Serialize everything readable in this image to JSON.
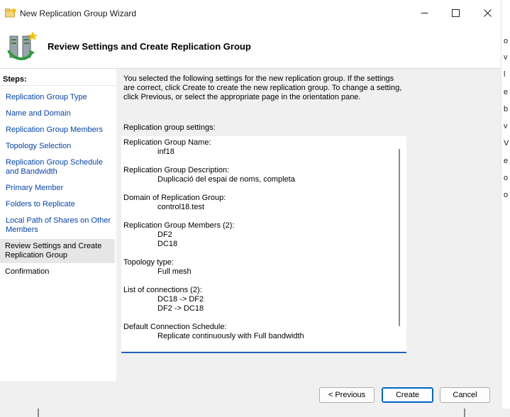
{
  "window": {
    "title": "New Replication Group Wizard"
  },
  "header": {
    "heading": "Review Settings and Create Replication Group"
  },
  "steps": {
    "heading": "Steps:",
    "items": [
      {
        "label": "Replication Group Type"
      },
      {
        "label": "Name and Domain"
      },
      {
        "label": "Replication Group Members"
      },
      {
        "label": "Topology Selection"
      },
      {
        "label": "Replication Group Schedule and Bandwidth"
      },
      {
        "label": "Primary Member"
      },
      {
        "label": "Folders to Replicate"
      },
      {
        "label": "Local Path of Shares on Other Members"
      },
      {
        "label": "Review Settings and Create Replication Group"
      },
      {
        "label": "Confirmation"
      }
    ]
  },
  "main": {
    "intro": "You selected the following settings for the new replication group. If the settings are correct, click Create to create the new replication group. To change a setting, click Previous, or select the appropriate page in the orientation pane.",
    "settings_label": "Replication group settings:",
    "settings": {
      "name_label": "Replication Group Name:",
      "name_value": "inf18",
      "desc_label": "Replication Group Description:",
      "desc_value": "Duplicació del espai de noms, completa",
      "domain_label": "Domain of Replication Group:",
      "domain_value": "control18.test",
      "members_label": "Replication Group Members (2):",
      "members": [
        "DF2",
        "DC18"
      ],
      "topology_label": "Topology type:",
      "topology_value": "Full mesh",
      "connections_label": "List of connections (2):",
      "connections": [
        "DC18 -> DF2",
        "DF2 -> DC18"
      ],
      "schedule_label": "Default Connection Schedule:",
      "schedule_value": "Replicate continuously with Full bandwidth"
    }
  },
  "footer": {
    "previous_label": "< Previous",
    "create_label": "Create",
    "cancel_label": "Cancel"
  },
  "background": {
    "glyphs": [
      "o",
      "v",
      "l",
      "e",
      "b",
      "v",
      "V",
      "e",
      "o",
      "o"
    ]
  },
  "colors": {
    "link": "#0645ad",
    "accent": "#0067c0",
    "pane_bg": "#f0f0f0"
  }
}
